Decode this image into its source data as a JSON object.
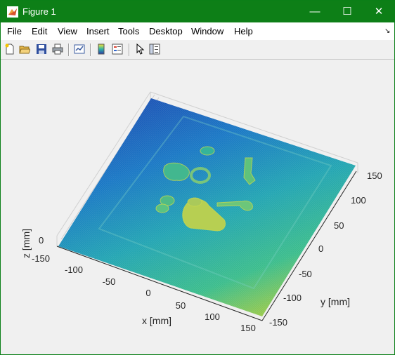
{
  "window": {
    "title": "Figure 1"
  },
  "title_buttons": {
    "minimize": "—",
    "maximize": "☐",
    "close": "✕"
  },
  "menu": [
    "File",
    "Edit",
    "View",
    "Insert",
    "Tools",
    "Desktop",
    "Window",
    "Help"
  ],
  "menu_overflow": "↘",
  "toolbar_icons": [
    "new-figure-icon",
    "open-file-icon",
    "save-icon",
    "print-icon",
    "link-plot-icon",
    "colorbar-icon",
    "legend-icon",
    "edit-plot-arrow-icon",
    "property-inspector-icon"
  ],
  "axes": {
    "x_label": "x [mm]",
    "y_label": "y [mm]",
    "z_label": "z [mm]",
    "x_ticks": [
      "-100",
      "-50",
      "0",
      "50",
      "100",
      "150"
    ],
    "y_ticks": [
      "150",
      "100",
      "50",
      "0",
      "-50",
      "-100",
      "-150"
    ],
    "z_tick": "0",
    "z_left_extra": "-150"
  },
  "colors": {
    "title_bar": "#0d7f17",
    "surface_blue": "#1f57b8",
    "surface_teal": "#2aa7a0",
    "surface_green": "#8dc84a"
  }
}
